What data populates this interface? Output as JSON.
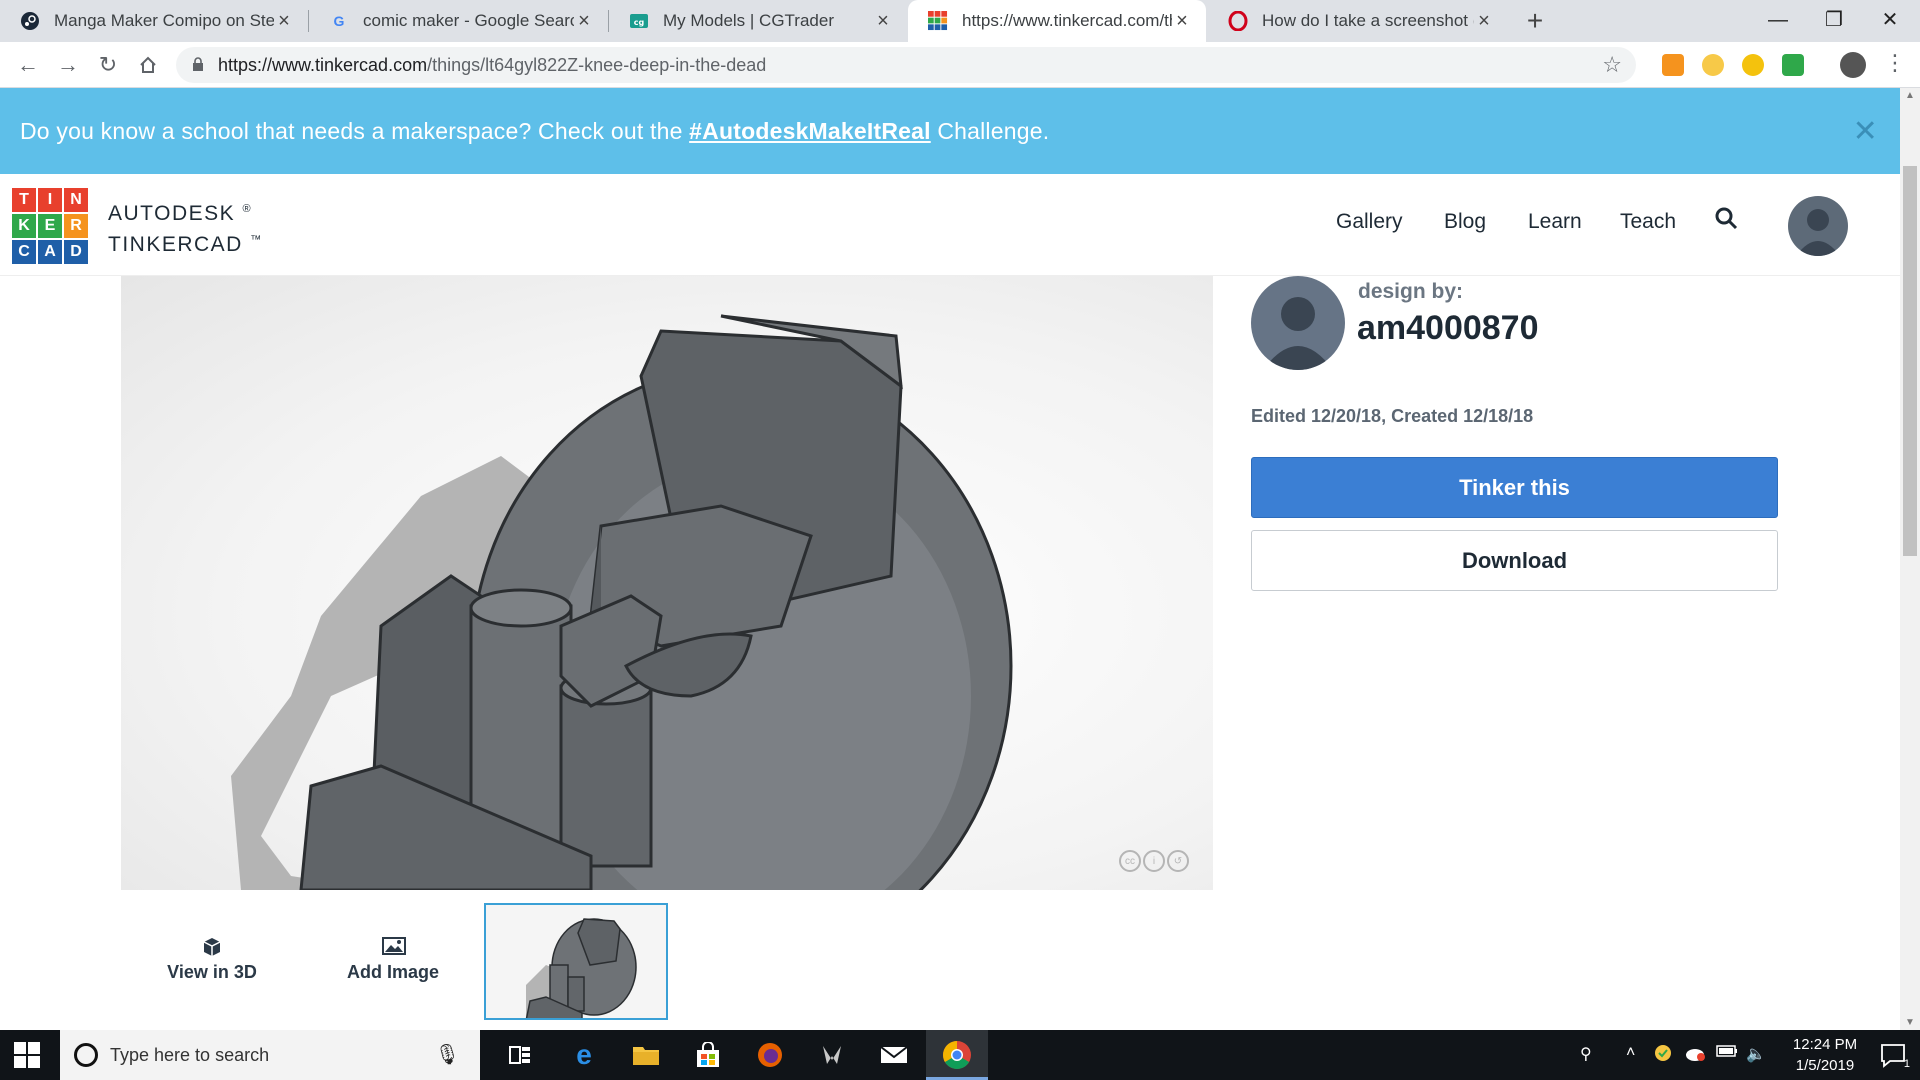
{
  "browser": {
    "tabs": [
      {
        "title": "Manga Maker Comipo on Steam",
        "favicon": "steam-icon",
        "active": false
      },
      {
        "title": "comic maker - Google Search",
        "favicon": "google-icon",
        "active": false
      },
      {
        "title": "My Models | CGTrader",
        "favicon": "cgtrader-icon",
        "active": false
      },
      {
        "title": "https://www.tinkercad.com/thing",
        "favicon": "tinkercad-icon",
        "active": true
      },
      {
        "title": "How do I take a screenshot (pictu",
        "favicon": "opera-icon",
        "active": false
      }
    ],
    "url_host": "https://www.tinkercad.com",
    "url_path": "/things/lt64gyl822Z-knee-deep-in-the-dead"
  },
  "banner": {
    "text_before": "Do you know a school that needs a makerspace? Check out the ",
    "link": "#AutodeskMakeItReal",
    "text_after": " Challenge."
  },
  "header": {
    "logo_letters": [
      "T",
      "I",
      "N",
      "K",
      "E",
      "R",
      "C",
      "A",
      "D"
    ],
    "brand_line1": "AUTODESK",
    "brand_line2": "TINKERCAD",
    "nav": [
      "Gallery",
      "Blog",
      "Learn",
      "Teach"
    ]
  },
  "design": {
    "design_by_label": "design by:",
    "creator": "am4000870",
    "dates": "Edited 12/20/18, Created 12/18/18",
    "tinker_button": "Tinker this",
    "download_button": "Download"
  },
  "viewer_actions": {
    "view3d": "View in 3D",
    "add_image": "Add Image"
  },
  "taskbar": {
    "search_placeholder": "Type here to search",
    "time": "12:24 PM",
    "date": "1/5/2019",
    "notifications": "1"
  },
  "colors": {
    "banner": "#5ebfe9",
    "primary_button": "#3b7fd4",
    "logo_red": "#e8402d",
    "logo_orange": "#f5931e",
    "logo_green": "#2fa84a",
    "logo_blue": "#1f5fa8"
  }
}
